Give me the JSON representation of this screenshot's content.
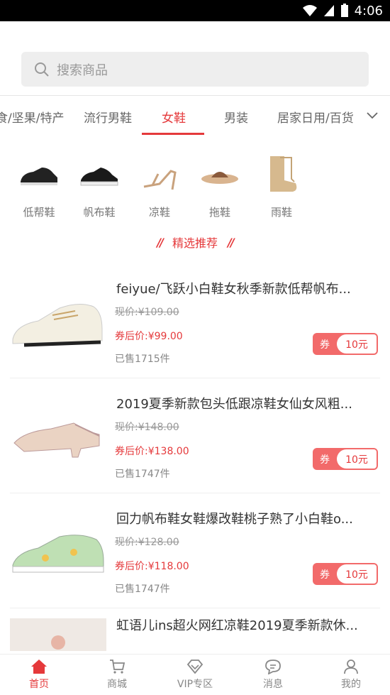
{
  "status": {
    "time": "4:06"
  },
  "search": {
    "placeholder": "搜索商品"
  },
  "categories": [
    {
      "label": "食/坚果/特产"
    },
    {
      "label": "流行男鞋"
    },
    {
      "label": "女鞋"
    },
    {
      "label": "男装"
    },
    {
      "label": "居家日用/百货"
    }
  ],
  "subcategories": [
    {
      "label": "低帮鞋"
    },
    {
      "label": "帆布鞋"
    },
    {
      "label": "凉鞋"
    },
    {
      "label": "拖鞋"
    },
    {
      "label": "雨鞋"
    }
  ],
  "section": {
    "title": "精选推荐",
    "deco_left": "//",
    "deco_right": "//"
  },
  "products": [
    {
      "title": "feiyue/飞跃小白鞋女秋季新款低帮帆布...",
      "orig": "现价:¥109.00",
      "after": "券后价:¥99.00",
      "sold": "已售1715件",
      "coupon_label": "券",
      "coupon_value": "10元"
    },
    {
      "title": "2019夏季新款包头低跟凉鞋女仙女风粗...",
      "orig": "现价:¥148.00",
      "after": "券后价:¥138.00",
      "sold": "已售1747件",
      "coupon_label": "券",
      "coupon_value": "10元"
    },
    {
      "title": "回力帆布鞋女鞋爆改鞋桃子熟了小白鞋o...",
      "orig": "现价:¥128.00",
      "after": "券后价:¥118.00",
      "sold": "已售1747件",
      "coupon_label": "券",
      "coupon_value": "10元"
    },
    {
      "title": "虹语儿ins超火网红凉鞋2019夏季新款休..."
    }
  ],
  "tabs": [
    {
      "label": "首页"
    },
    {
      "label": "商城"
    },
    {
      "label": "VIP专区"
    },
    {
      "label": "消息"
    },
    {
      "label": "我的"
    }
  ],
  "colors": {
    "accent": "#e5393b"
  }
}
